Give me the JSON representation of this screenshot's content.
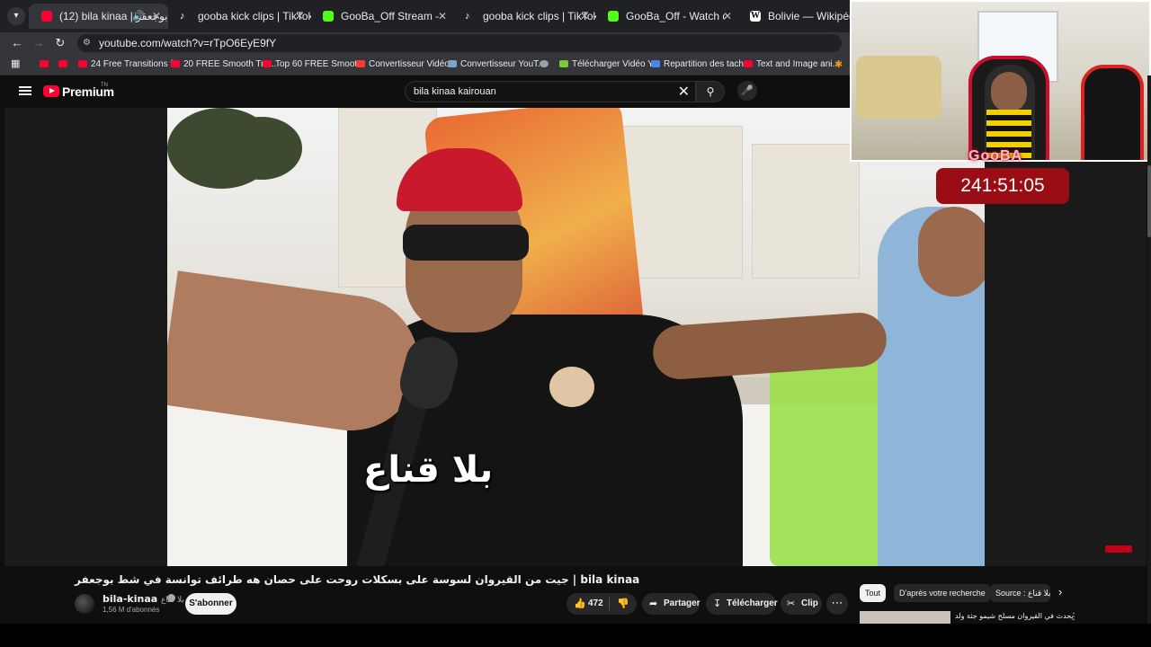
{
  "browser": {
    "tab_menu_icon": "chevron-down-icon",
    "tabs": [
      {
        "label": "(12) bila kinaa | بلا قناع شط بوجعفر",
        "favicon": "youtube",
        "active": true
      },
      {
        "label": "gooba kick clips | TikTok(+99)",
        "favicon": "tiktok"
      },
      {
        "label": "GooBa_Off Stream - Watch Live",
        "favicon": "kick"
      },
      {
        "label": "gooba kick clips | TikTok(+99)",
        "favicon": "tiktok"
      },
      {
        "label": "GooBa_Off - Watch clips on Kick",
        "favicon": "kick"
      },
      {
        "label": "Bolivie — Wikipédia",
        "favicon": "wikipedia"
      }
    ],
    "url": "youtube.com/watch?v=rTpO6EyE9fY",
    "bookmarks": [
      {
        "label": ""
      },
      {
        "label": ""
      },
      {
        "label": "24 Free Transitions f..."
      },
      {
        "label": "20 FREE Smooth Tra..."
      },
      {
        "label": "Top 60 FREE Smoot..."
      },
      {
        "label": "Convertisseur Vidéo..."
      },
      {
        "label": "Convertisseur YouT..."
      },
      {
        "label": ""
      },
      {
        "label": "Télécharger Vidéo Y..."
      },
      {
        "label": "Repartition des tach..."
      },
      {
        "label": "Text and Image ani..."
      }
    ]
  },
  "youtube": {
    "brand": "Premium",
    "brand_sup": "TN",
    "search_query": "bila kinaa kairouan",
    "video": {
      "caption": "بلا قناع",
      "title": "جيت من القيروان لسوسة على بسكلات روحت على حصان هه طرائف توانسة في شط بوجعفر | bila kinaa",
      "channel": "bila-kinaa",
      "channel_suffix": "بلا قناع",
      "subscribers": "1,56 M d'abonnés",
      "subscribe_label": "S'abonner",
      "likes": "472",
      "share_label": "Partager",
      "download_label": "Télécharger",
      "clip_label": "Clip"
    },
    "chips": [
      {
        "label": "Tout",
        "active": true
      },
      {
        "label": "D'après votre recherche",
        "active": false
      },
      {
        "label": "Source : بلا قناع",
        "active": false
      }
    ],
    "recommendation_title": "يحدث في القيروان مسلح شيمو جثة ولد"
  },
  "stream_overlay": {
    "streamer_tag": "GooBA",
    "timer": "241:51:05"
  },
  "colors": {
    "accent": "#ff0033",
    "timer_bg": "#9b0d15",
    "kick_green": "#53fc18"
  }
}
